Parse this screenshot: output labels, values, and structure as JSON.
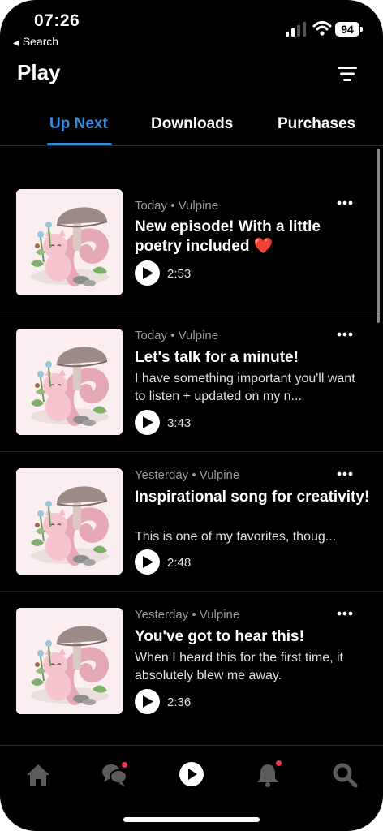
{
  "status": {
    "time": "07:26",
    "back_label": "Search",
    "battery": "94"
  },
  "header": {
    "title": "Play"
  },
  "tabs": [
    {
      "label": "Up Next",
      "active": true
    },
    {
      "label": "Downloads",
      "active": false
    },
    {
      "label": "Purchases",
      "active": false
    }
  ],
  "episodes": [
    {
      "meta": "Today • Vulpine",
      "title": "New episode! With a little poetry included ❤️",
      "description": "",
      "duration": "2:53"
    },
    {
      "meta": "Today • Vulpine",
      "title": "Let's talk for a minute!",
      "description": "I have something important you'll want to listen + updated on my n...",
      "duration": "3:43"
    },
    {
      "meta": "Yesterday • Vulpine",
      "title": "Inspirational song for creativity!",
      "description": "This is one of my favorites, thoug...",
      "duration": "2:48"
    },
    {
      "meta": "Yesterday • Vulpine",
      "title": "You've got to hear this!",
      "description": "When I heard this for the first time, it absolutely blew me away.",
      "duration": "2:36"
    }
  ],
  "bottom_nav": [
    {
      "icon": "home-icon",
      "notification": false
    },
    {
      "icon": "chat-icon",
      "notification": true
    },
    {
      "icon": "play-icon",
      "notification": false
    },
    {
      "icon": "bell-icon",
      "notification": true
    },
    {
      "icon": "search-icon",
      "notification": false
    }
  ],
  "colors": {
    "accent": "#3a8ddb",
    "badge": "#ef3b4d",
    "background": "#000000"
  }
}
